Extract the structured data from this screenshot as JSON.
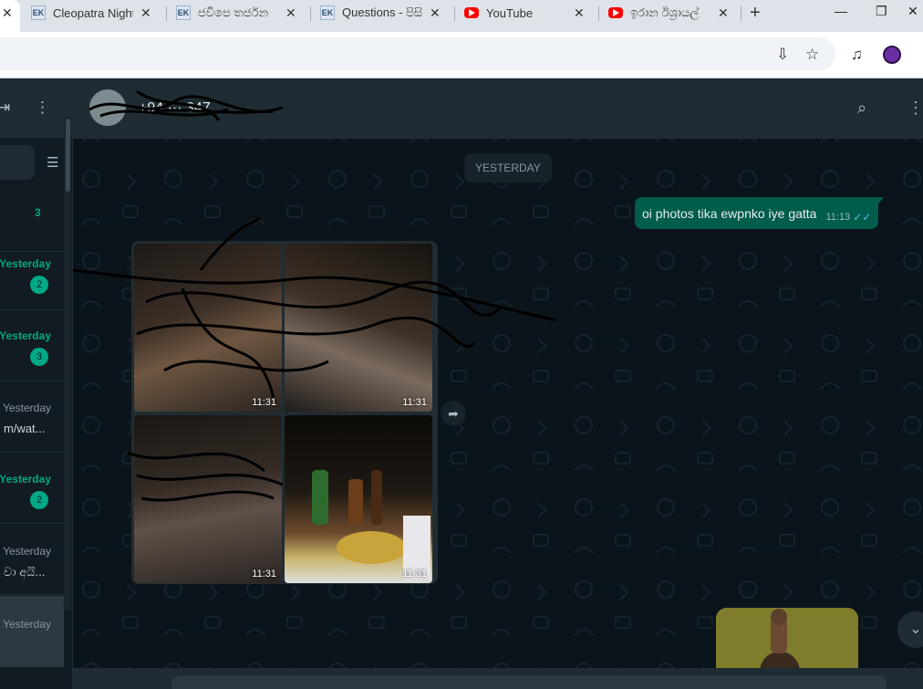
{
  "browser": {
    "first_tab_close": "✕",
    "tabs": [
      {
        "title": "Cleopatra Nightc",
        "favicon": "EK"
      },
      {
        "title": "ජවිපෙ තර්ජන",
        "favicon": "EK"
      },
      {
        "title": "Questions - පිසි",
        "favicon": "EK"
      },
      {
        "title": "YouTube",
        "favicon": "youtube-icon"
      },
      {
        "title": "ඉරාන ඊශ්‍රායල්",
        "favicon": "youtube-icon"
      }
    ],
    "tab_close": "✕",
    "new_tab": "+",
    "window_controls": {
      "minimize": "—",
      "restore": "❐",
      "close": "✕"
    },
    "toolbar_icons": {
      "install": "⇩",
      "bookmark": "☆",
      "media": "♫"
    }
  },
  "sidebar": {
    "icons": {
      "new_chat": "⇥",
      "menu": "⋮",
      "filter": "☰"
    },
    "chats": [
      {
        "time": "",
        "time_green": false,
        "preview": "",
        "badge": "3",
        "badge_style": "plain"
      },
      {
        "time": "Yesterday",
        "time_green": true,
        "preview": "",
        "badge": "2",
        "badge_style": "circle"
      },
      {
        "time": "Yesterday",
        "time_green": true,
        "preview": "",
        "badge": "3",
        "badge_style": "circle"
      },
      {
        "time": "Yesterday",
        "time_green": false,
        "preview": "m/wat...",
        "badge": "",
        "badge_style": "none"
      },
      {
        "time": "Yesterday",
        "time_green": true,
        "preview": "",
        "badge": "2",
        "badge_style": "circle"
      },
      {
        "time": "Yesterday",
        "time_green": false,
        "preview": "වා අයි...",
        "badge": "",
        "badge_style": "none"
      },
      {
        "time": "Yesterday",
        "time_green": false,
        "preview": "",
        "badge": "",
        "badge_style": "none",
        "selected": true
      }
    ]
  },
  "conversation": {
    "contact_name": "+94 ··· 347",
    "header_icons": {
      "search": "⌕",
      "menu": "⋮"
    },
    "date_chip": "YESTERDAY",
    "outgoing": {
      "text": "oi photos tika ewpnko iye gatta",
      "time": "11:13",
      "ticks": "✓✓"
    },
    "album_times": [
      "11:31",
      "11:31",
      "11:31",
      "11:31"
    ],
    "forward_icon": "➦",
    "scroll_down_icon": "⌄"
  },
  "colors": {
    "accent": "#00a884",
    "outgoing_bubble": "#005c4b",
    "panel": "#202c33",
    "background": "#0b141a"
  }
}
